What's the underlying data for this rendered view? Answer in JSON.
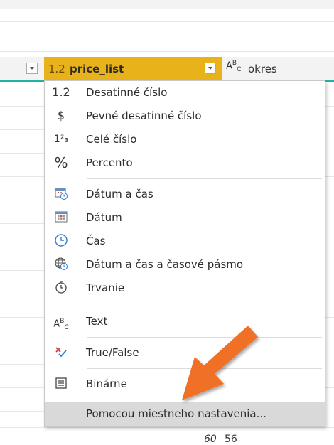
{
  "header": {
    "price_column": {
      "type_glyph": "1.2",
      "title": "price_list"
    },
    "next_column": {
      "type_glyph_main": "A",
      "type_glyph_sup": "B",
      "type_glyph_sub": "C",
      "title": "okres"
    }
  },
  "menu": {
    "items": [
      {
        "icon": "1.2",
        "label": "Desatinné číslo"
      },
      {
        "icon": "$",
        "label": "Pevné desatinné číslo"
      },
      {
        "icon": "1²₃",
        "label": "Celé číslo"
      },
      {
        "icon": "%",
        "label": "Percento"
      },
      {
        "icon": "datetime-icon",
        "label": "Dátum a čas"
      },
      {
        "icon": "calendar-icon",
        "label": "Dátum"
      },
      {
        "icon": "clock-icon",
        "label": "Čas"
      },
      {
        "icon": "globe-clock-icon",
        "label": "Dátum a čas a časové pásmo"
      },
      {
        "icon": "stopwatch-icon",
        "label": "Trvanie"
      },
      {
        "icon": "ABC",
        "label": "Text"
      },
      {
        "icon": "true-false-icon",
        "label": "True/False"
      },
      {
        "icon": "binary-icon",
        "label": "Binárne"
      },
      {
        "icon": "",
        "label": "Pomocou miestneho nastavenia..."
      }
    ]
  },
  "bottom_row": {
    "value_1": "60",
    "value_2": "56"
  },
  "colors": {
    "header_accent": "#e8b21b",
    "teal_line": "#1fb3a3",
    "arrow": "#f07025",
    "highlight": "#d9d9d9"
  }
}
